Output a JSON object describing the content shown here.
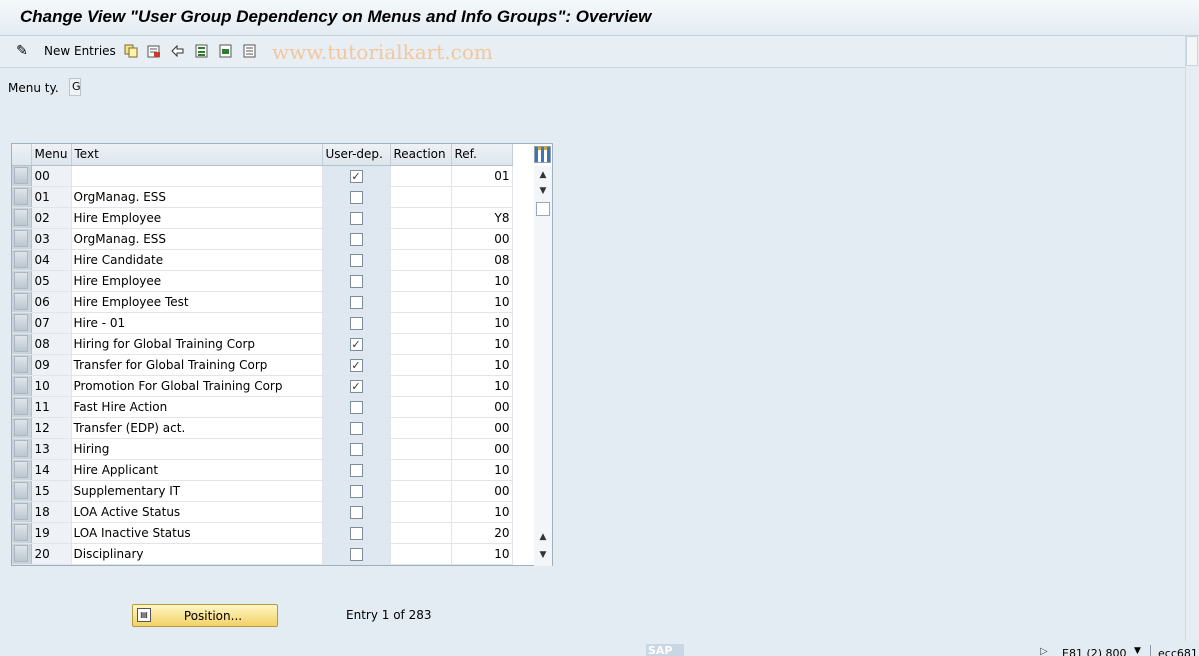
{
  "title": "Change View \"User Group Dependency on Menus and Info Groups\": Overview",
  "toolbar": {
    "new_entries_label": "New Entries",
    "watermark": "www.tutorialkart.com",
    "icons": [
      "pencil-glasses-icon",
      "copy-icon",
      "delete-icon",
      "undo-icon",
      "select-all-icon",
      "select-block-icon",
      "deselect-all-icon"
    ]
  },
  "filter": {
    "label": "Menu ty.",
    "value": "G"
  },
  "table": {
    "columns": {
      "menu": "Menu",
      "text": "Text",
      "userdep": "User-dep.",
      "reaction": "Reaction",
      "ref": "Ref."
    },
    "rows": [
      {
        "menu": "00",
        "text": "",
        "checked": true,
        "reaction": "",
        "ref": "01"
      },
      {
        "menu": "01",
        "text": "OrgManag. ESS",
        "checked": false,
        "reaction": "",
        "ref": ""
      },
      {
        "menu": "02",
        "text": "Hire Employee",
        "checked": false,
        "reaction": "",
        "ref": "Y8"
      },
      {
        "menu": "03",
        "text": "OrgManag. ESS",
        "checked": false,
        "reaction": "",
        "ref": "00"
      },
      {
        "menu": "04",
        "text": "Hire Candidate",
        "checked": false,
        "reaction": "",
        "ref": "08"
      },
      {
        "menu": "05",
        "text": "Hire Employee",
        "checked": false,
        "reaction": "",
        "ref": "10"
      },
      {
        "menu": "06",
        "text": "Hire Employee Test",
        "checked": false,
        "reaction": "",
        "ref": "10"
      },
      {
        "menu": "07",
        "text": "Hire - 01",
        "checked": false,
        "reaction": "",
        "ref": "10"
      },
      {
        "menu": "08",
        "text": "Hiring for Global Training Corp",
        "checked": true,
        "reaction": "",
        "ref": "10"
      },
      {
        "menu": "09",
        "text": "Transfer for Global Training Corp",
        "checked": true,
        "reaction": "",
        "ref": "10"
      },
      {
        "menu": "10",
        "text": "Promotion For Global Training Corp",
        "checked": true,
        "reaction": "",
        "ref": "10"
      },
      {
        "menu": "11",
        "text": "Fast Hire Action",
        "checked": false,
        "reaction": "",
        "ref": "00"
      },
      {
        "menu": "12",
        "text": "Transfer (EDP) act.",
        "checked": false,
        "reaction": "",
        "ref": "00"
      },
      {
        "menu": "13",
        "text": "Hiring",
        "checked": false,
        "reaction": "",
        "ref": "00"
      },
      {
        "menu": "14",
        "text": "Hire Applicant",
        "checked": false,
        "reaction": "",
        "ref": "10"
      },
      {
        "menu": "15",
        "text": "Supplementary IT",
        "checked": false,
        "reaction": "",
        "ref": "00"
      },
      {
        "menu": "18",
        "text": "LOA Active Status",
        "checked": false,
        "reaction": "",
        "ref": "10"
      },
      {
        "menu": "19",
        "text": "LOA Inactive Status",
        "checked": false,
        "reaction": "",
        "ref": "20"
      },
      {
        "menu": "20",
        "text": "Disciplinary",
        "checked": false,
        "reaction": "",
        "ref": "10"
      }
    ]
  },
  "position_button": "Position...",
  "entry_info": "Entry 1 of 283",
  "status": {
    "sap_logo": "SAP",
    "system": "E81 (2) 800",
    "server": "ecc681"
  }
}
